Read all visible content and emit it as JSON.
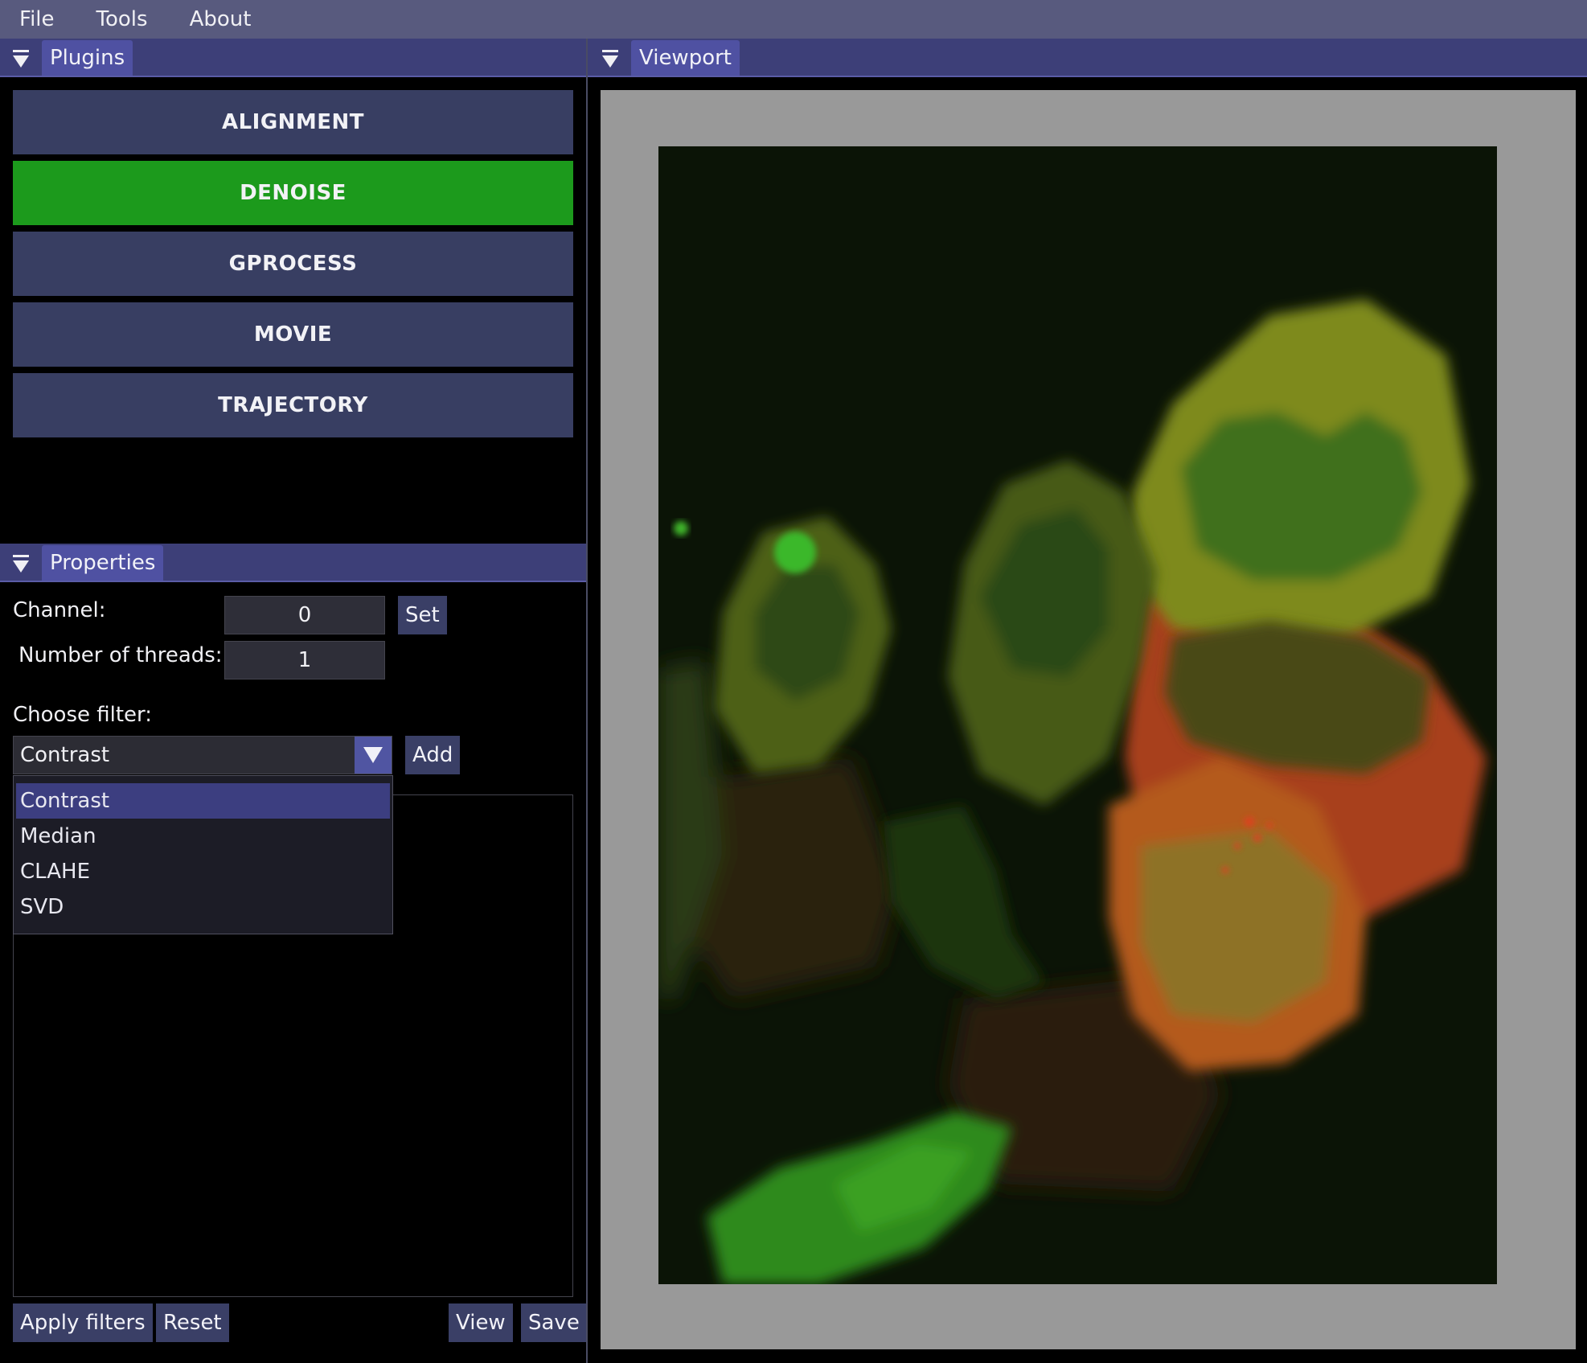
{
  "menubar": {
    "items": [
      "File",
      "Tools",
      "About"
    ]
  },
  "plugins_panel": {
    "title": "Plugins"
  },
  "plugins": [
    {
      "label": "ALIGNMENT",
      "active": false
    },
    {
      "label": "DENOISE",
      "active": true
    },
    {
      "label": "GPROCESS",
      "active": false
    },
    {
      "label": "MOVIE",
      "active": false
    },
    {
      "label": "TRAJECTORY",
      "active": false
    }
  ],
  "properties_panel": {
    "title": "Properties",
    "channel_label": "Channel:",
    "channel_value": "0",
    "set_label": "Set",
    "threads_label": "Number of threads:",
    "threads_value": "1",
    "choose_filter_label": "Choose filter:",
    "filter_selected": "Contrast",
    "add_label": "Add",
    "filter_options": [
      "Contrast",
      "Median",
      "CLAHE",
      "SVD"
    ],
    "apply_label": "Apply filters",
    "reset_label": "Reset",
    "view_label": "View",
    "save_label": "Save"
  },
  "viewport_panel": {
    "title": "Viewport"
  },
  "colors": {
    "menubar": "#585a7e",
    "panel_header": "#3d3f78",
    "tab": "#4f51a2",
    "plugin_button": "#383e62",
    "plugin_active": "#1c9a1c",
    "viewport_bg": "#999999"
  }
}
